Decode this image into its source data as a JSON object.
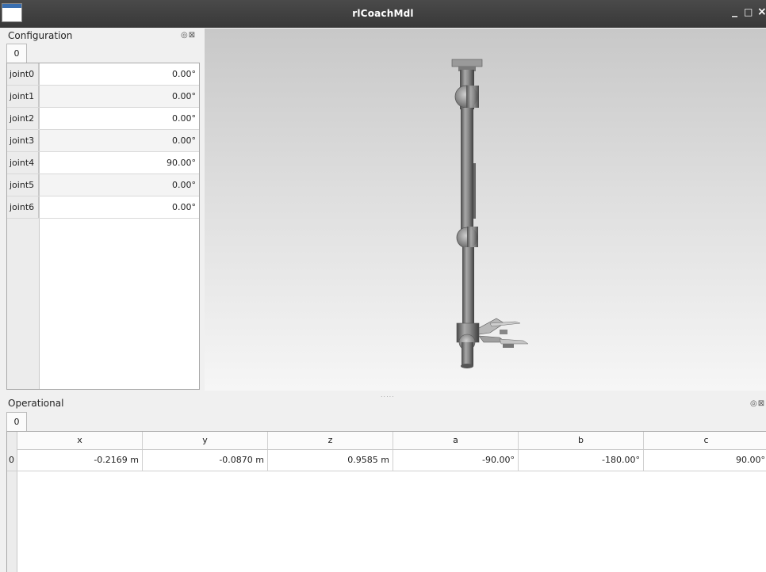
{
  "window": {
    "title": "rlCoachMdl",
    "minimize": "_",
    "maximize": "□",
    "close": "×"
  },
  "configuration": {
    "title": "Configuration",
    "dock_buttons": "◎⊠",
    "tab": "0",
    "joints": [
      {
        "name": "joint0",
        "value": "0.00°"
      },
      {
        "name": "joint1",
        "value": "0.00°"
      },
      {
        "name": "joint2",
        "value": "0.00°"
      },
      {
        "name": "joint3",
        "value": "0.00°"
      },
      {
        "name": "joint4",
        "value": "90.00°"
      },
      {
        "name": "joint5",
        "value": "0.00°"
      },
      {
        "name": "joint6",
        "value": "0.00°"
      }
    ]
  },
  "viewport": {
    "splitter": "....."
  },
  "operational": {
    "title": "Operational",
    "dock_buttons": "◎⊠",
    "tab": "0",
    "columns": [
      "x",
      "y",
      "z",
      "a",
      "b",
      "c"
    ],
    "rows": [
      {
        "index": "0",
        "values": [
          "-0.2169 m",
          "-0.0870 m",
          "0.9585 m",
          "-90.00°",
          "-180.00°",
          "90.00°"
        ]
      }
    ]
  }
}
